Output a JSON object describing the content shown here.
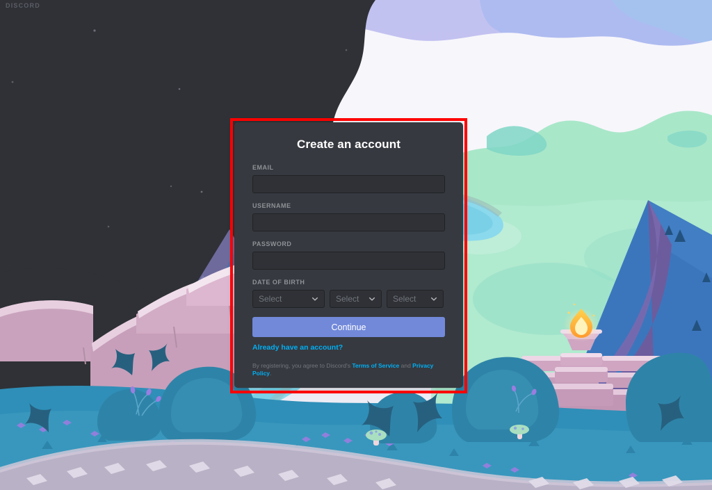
{
  "brand": {
    "wordmark": "DISCORD",
    "blurple": "#7289da",
    "link_blue": "#00aff4",
    "panel_bg": "#36393f",
    "input_bg": "#2f3136",
    "highlight_border": "#fe0000"
  },
  "form": {
    "title": "Create an account",
    "fields": [
      {
        "label": "EMAIL",
        "value": "",
        "placeholder": "",
        "type": "email",
        "name": "email"
      },
      {
        "label": "USERNAME",
        "value": "",
        "placeholder": "",
        "type": "text",
        "name": "username"
      },
      {
        "label": "PASSWORD",
        "value": "",
        "placeholder": "",
        "type": "password",
        "name": "password"
      }
    ],
    "date_of_birth": {
      "label": "DATE OF BIRTH",
      "month": {
        "value": "Select",
        "icon": "chevron-down-icon"
      },
      "day": {
        "value": "Select",
        "icon": "chevron-down-icon"
      },
      "year": {
        "value": "Select",
        "icon": "chevron-down-icon"
      }
    },
    "submit_label": "Continue",
    "login_link": "Already have an account?",
    "legal": {
      "prefix": "By registering, you agree to Discord's ",
      "terms": "Terms of Service",
      "conjunction": " and ",
      "privacy": "Privacy Policy",
      "suffix": "."
    }
  },
  "scene": {
    "description": "Discord login background illustration: dark cliff silhouette at upper left, pale lavender sky, mint-green hills, cyan river, blue mountain, pink stone terraces and altar with lit brazier, teal foliage and cobblestone path"
  }
}
